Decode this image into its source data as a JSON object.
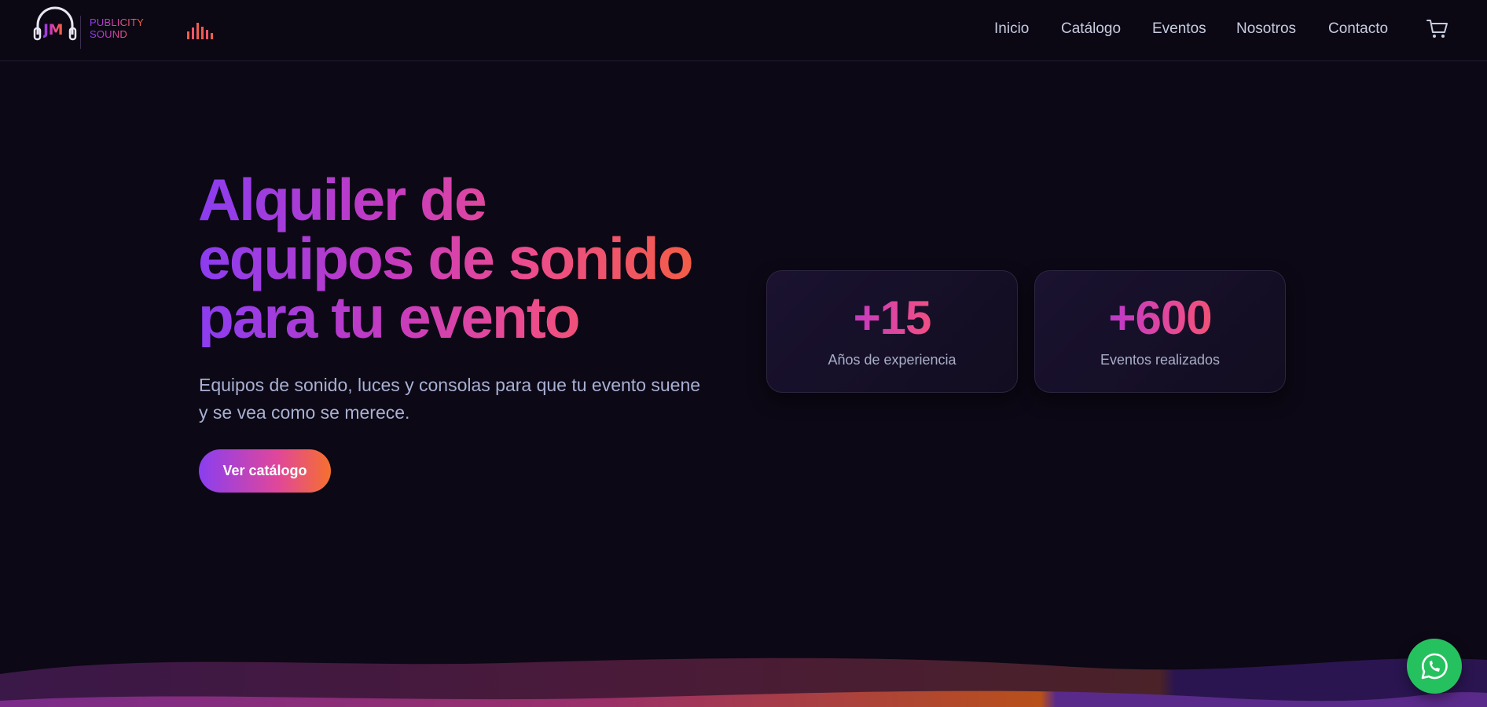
{
  "brand": {
    "initials": "JM",
    "line1": "PUBLICITY",
    "line2": "SOUND",
    "logo_icon": "headphones-icon",
    "extra_icon": "equalizer-icon"
  },
  "nav": {
    "items": [
      "Inicio",
      "Catálogo",
      "Eventos",
      "Nosotros",
      "Contacto"
    ],
    "cart_icon": "cart-icon"
  },
  "hero": {
    "title_line1": "Alquiler de",
    "title_line2": "equipos de sonido",
    "title_line3": "para tu evento",
    "subtitle": "Equipos de sonido, luces y consolas para que tu evento suene y se vea como se merece.",
    "cta_label": "Ver catálogo"
  },
  "stats": [
    {
      "value": "+15",
      "label": "Años de experiencia"
    },
    {
      "value": "+600",
      "label": "Eventos realizados"
    }
  ],
  "floating": {
    "whatsapp_icon": "whatsapp-icon"
  },
  "colors": {
    "background": "#0c0815",
    "gradient_start": "#8b3cf0",
    "gradient_mid": "#ec4c8e",
    "gradient_end": "#f5622f",
    "whatsapp": "#26c15f"
  }
}
